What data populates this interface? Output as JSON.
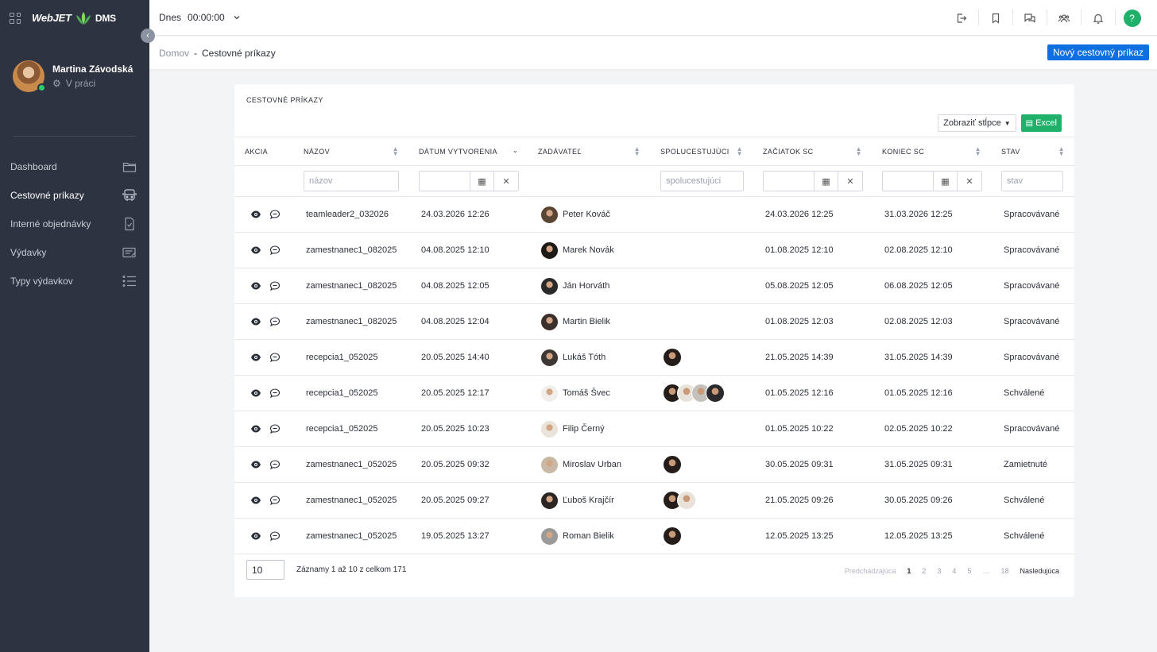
{
  "topbar": {
    "today_label": "Dnes",
    "time": "00:00:00",
    "icons": [
      "logout-icon",
      "bookmark-icon",
      "chat-icon",
      "users-icon",
      "bell-icon",
      "help-icon"
    ],
    "help_label": "?"
  },
  "brand": {
    "web": "WebJET",
    "dms": "DMS"
  },
  "user": {
    "name": "Martina Závodská",
    "status": "V práci"
  },
  "sidebar": {
    "items": [
      {
        "label": "Dashboard",
        "icon": "folder-icon"
      },
      {
        "label": "Cestovné príkazy",
        "icon": "bus-icon"
      },
      {
        "label": "Interné objednávky",
        "icon": "document-check-icon"
      },
      {
        "label": "Výdavky",
        "icon": "receipt-icon"
      },
      {
        "label": "Typy výdavkov",
        "icon": "list-icon"
      }
    ]
  },
  "breadcrumb": {
    "home": "Domov",
    "separator": "-",
    "current": "Cestovné príkazy"
  },
  "actions": {
    "new_button": "Nový cestovný príkaz"
  },
  "card": {
    "title": "CESTOVNÉ PRÍKAZY",
    "columns_button": "Zobraziť stĺpce",
    "excel_button": "Excel"
  },
  "table": {
    "headers": [
      "AKCIA",
      "NÁZOV",
      "DÁTUM VYTVORENIA",
      "ZADÁVATEĽ",
      "SPOLUCESTUJÚCI",
      "ZAČIATOK SC",
      "KONIEC SC",
      "STAV"
    ],
    "filters": {
      "nazov": "názov",
      "spolucestujuci": "spolucestujúci",
      "stav": "stav"
    },
    "rows": [
      {
        "nazov": "teamleader2_032026",
        "datum": "24.03.2026 12:26",
        "zadavatel": "Peter Kováč",
        "companions": 0,
        "zaciatok": "24.03.2026 12:25",
        "koniec": "31.03.2026 12:25",
        "stav": "Spracovávané"
      },
      {
        "nazov": "zamestnanec1_082025",
        "datum": "04.08.2025 12:10",
        "zadavatel": "Marek Novák",
        "companions": 0,
        "zaciatok": "01.08.2025 12:10",
        "koniec": "02.08.2025 12:10",
        "stav": "Spracovávané"
      },
      {
        "nazov": "zamestnanec1_082025",
        "datum": "04.08.2025 12:05",
        "zadavatel": "Ján Horváth",
        "companions": 0,
        "zaciatok": "05.08.2025 12:05",
        "koniec": "06.08.2025 12:05",
        "stav": "Spracovávané"
      },
      {
        "nazov": "zamestnanec1_082025",
        "datum": "04.08.2025 12:04",
        "zadavatel": "Martin Bielik",
        "companions": 0,
        "zaciatok": "01.08.2025 12:03",
        "koniec": "02.08.2025 12:03",
        "stav": "Spracovávané"
      },
      {
        "nazov": "recepcia1_052025",
        "datum": "20.05.2025 14:40",
        "zadavatel": "Lukáš Tóth",
        "companions": 1,
        "zaciatok": "21.05.2025 14:39",
        "koniec": "31.05.2025 14:39",
        "stav": "Spracovávané"
      },
      {
        "nazov": "recepcia1_052025",
        "datum": "20.05.2025 12:17",
        "zadavatel": "Tomáš Švec",
        "companions": 4,
        "zaciatok": "01.05.2025 12:16",
        "koniec": "01.05.2025 12:16",
        "stav": "Schválené"
      },
      {
        "nazov": "recepcia1_052025",
        "datum": "20.05.2025 10:23",
        "zadavatel": "Filip Černý",
        "companions": 0,
        "zaciatok": "01.05.2025 10:22",
        "koniec": "02.05.2025 10:22",
        "stav": "Spracovávané"
      },
      {
        "nazov": "zamestnanec1_052025",
        "datum": "20.05.2025 09:32",
        "zadavatel": "Miroslav Urban",
        "companions": 1,
        "zaciatok": "30.05.2025 09:31",
        "koniec": "31.05.2025 09:31",
        "stav": "Zamietnuté"
      },
      {
        "nazov": "zamestnanec1_052025",
        "datum": "20.05.2025 09:27",
        "zadavatel": "Ľuboš Krajčír",
        "companions": 2,
        "zaciatok": "21.05.2025 09:26",
        "koniec": "30.05.2025 09:26",
        "stav": "Schválené"
      },
      {
        "nazov": "zamestnanec1_052025",
        "datum": "19.05.2025 13:27",
        "zadavatel": "Roman Bielik",
        "companions": 1,
        "zaciatok": "12.05.2025 13:25",
        "koniec": "12.05.2025 13:25",
        "stav": "Schválené"
      }
    ]
  },
  "footer": {
    "page_size": "10",
    "info": "Záznamy 1 až 10 z celkom 171",
    "pager": {
      "prev": "Predchádzajúca",
      "pages": [
        "1",
        "2",
        "3",
        "4",
        "5",
        "…",
        "18"
      ],
      "current": "1",
      "next": "Nasledujúca"
    }
  },
  "colors": {
    "sidebar": "#2d3340",
    "primary": "#0d6fe0",
    "success": "#1fb16a",
    "online": "#2ecc71"
  }
}
